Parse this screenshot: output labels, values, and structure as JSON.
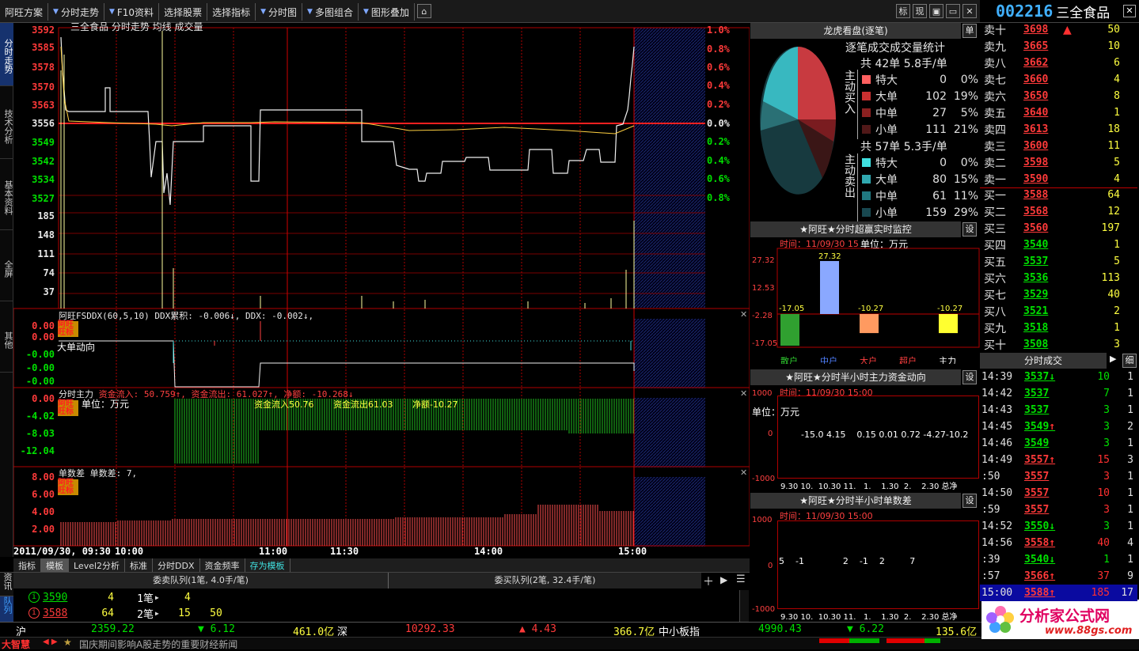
{
  "menu": {
    "items": [
      "阿旺方案",
      "分时走势",
      "F10资料",
      "选择股票",
      "选择指标",
      "分时图",
      "多图组合",
      "图形叠加"
    ],
    "right_buttons": [
      "标",
      "现"
    ]
  },
  "stock": {
    "code": "002216",
    "name": "三全食品"
  },
  "leftnav": [
    "分时走势",
    "技术分析",
    "基本资料",
    "全屏",
    "其他"
  ],
  "chart": {
    "title": "三全食品 分时走势 均线 成交量",
    "price_ticks": [
      "3592",
      "3585",
      "3578",
      "3570",
      "3563",
      "3556",
      "3549",
      "3542",
      "3534",
      "3527"
    ],
    "pct_ticks": [
      "1.0%",
      "0.8%",
      "0.6%",
      "0.4%",
      "0.2%",
      "0.0%",
      "0.2%",
      "0.4%",
      "0.6%",
      "0.8%"
    ],
    "vol_ticks": [
      "185",
      "148",
      "111",
      "74",
      "37"
    ],
    "ddx_label": "阿旺FSDDX(60,5,10)  DDX累积: -0.006↓, DDX: -0.002↓,",
    "ddx_ticks": [
      "0.00",
      "0.00",
      "-0.00",
      "-0.00",
      "-0.00"
    ],
    "ddx_sub": "大单动向",
    "flow_label_a": "分时主力",
    "flow_label_b": "资金流入: 50.759↑, 资金流出: 61.027↑, 净额: -10.268↓",
    "flow_ticks": [
      "0.00",
      "-4.02",
      "-8.03",
      "-12.04"
    ],
    "flow_unit": "单位：万元",
    "flow_in": "资金流入50.76",
    "flow_out": "资金流出61.03",
    "flow_net": "净额-10.27",
    "diff_label": "单数差  单数差: 7,",
    "diff_ticks": [
      "8.00",
      "6.00",
      "4.00",
      "2.00"
    ],
    "badge": "阿旺\n旺标",
    "time_axis": [
      "2011/09/30, 09:30",
      "10:00",
      "11:00",
      "11:30",
      "14:00",
      "15:00"
    ]
  },
  "tabs": [
    "指标",
    "模板",
    "Level2分析",
    "标准",
    "分时DDX",
    "资金频率",
    "存为模板"
  ],
  "queue": {
    "side_tabs": [
      "资讯",
      "队列"
    ],
    "sell_title": "委卖队列(1笔, 4.0手/笔)",
    "buy_title": "委买队列(2笔, 32.4手/笔)",
    "rows": [
      {
        "price": "3590",
        "vol": "4",
        "count": "1笔",
        "items": [
          "4"
        ]
      },
      {
        "price": "3588",
        "vol": "64",
        "count": "2笔",
        "items": [
          "15",
          "50"
        ]
      }
    ]
  },
  "dragon": {
    "header": "龙虎看盘(逐笔)",
    "btn": "单",
    "subtitle": "逐笔成交成交量统计",
    "buy_total": "共 42单 5.8手/单",
    "sell_total": "共 57单 5.3手/单",
    "buy_label": "主动买入",
    "sell_label": "主动卖出",
    "buy_rows": [
      {
        "name": "特大",
        "n": "0",
        "p": "0%",
        "color": "#ff6060"
      },
      {
        "name": "大单",
        "n": "102",
        "p": "19%",
        "color": "#c83030"
      },
      {
        "name": "中单",
        "n": "27",
        "p": "5%",
        "color": "#8a2020"
      },
      {
        "name": "小单",
        "n": "111",
        "p": "21%",
        "color": "#501818"
      }
    ],
    "sell_rows": [
      {
        "name": "特大",
        "n": "0",
        "p": "0%",
        "color": "#40e0e0"
      },
      {
        "name": "大单",
        "n": "80",
        "p": "15%",
        "color": "#30a8b0"
      },
      {
        "name": "中单",
        "n": "61",
        "p": "11%",
        "color": "#207880"
      },
      {
        "name": "小单",
        "n": "159",
        "p": "29%",
        "color": "#184850"
      }
    ]
  },
  "monitor": {
    "header": "★阿旺★分时超赢实时监控",
    "btn": "设",
    "time": "时间：11/09/30 15",
    "unit": "单位：万元",
    "ticks": [
      "27.32",
      "12.53",
      "-2.28",
      "-17.05"
    ],
    "bars": [
      {
        "cat": "散户",
        "val": -17.05,
        "label": "-17.05",
        "color": "#30a030"
      },
      {
        "cat": "中户",
        "val": 27.32,
        "label": "27.32",
        "color": "#8aa8ff"
      },
      {
        "cat": "大户",
        "val": -10.27,
        "label": "-10.27",
        "color": "#ff9a60"
      },
      {
        "cat": "超户",
        "val": 0,
        "label": "",
        "color": "#ff4040"
      },
      {
        "cat": "主力",
        "val": -10.27,
        "label": "-10.27",
        "color": "#ffff30"
      }
    ],
    "colors": {
      "散户": "#30d030",
      "中户": "#5080ff",
      "大户": "#ff4040",
      "超户": "#ff4040",
      "主力": "#ffffff"
    }
  },
  "halfhour": {
    "header": "★阿旺★分时半小时主力资金动向",
    "btn": "设",
    "time": "时间：11/09/30 15:00",
    "unit": "单位：万元",
    "vals": "-15.0 4.15    0.15 0.01 0.72 -4.27-10.2",
    "ticks": [
      "1000",
      "0",
      "-1000"
    ],
    "axis": "9.30 10.  10.30 11.   1.    1.30  2.    2.30 总净"
  },
  "diffhalf": {
    "header": "★阿旺★分时半小时单数差",
    "btn": "设",
    "time": "时间：11/09/30 15:00",
    "vals": "5    -1              2    -1    2         7",
    "ticks": [
      "1000",
      "0",
      "-1000"
    ],
    "axis": "9.30 10.  10.30 11.   1.    1.30  2.    2.30 总净"
  },
  "orderbook": {
    "sells": [
      {
        "l": "卖十",
        "p": "3698",
        "v": "50",
        "up": true
      },
      {
        "l": "卖九",
        "p": "3665",
        "v": "10"
      },
      {
        "l": "卖八",
        "p": "3662",
        "v": "6"
      },
      {
        "l": "卖七",
        "p": "3660",
        "v": "4"
      },
      {
        "l": "卖六",
        "p": "3650",
        "v": "8"
      },
      {
        "l": "卖五",
        "p": "3640",
        "v": "1"
      },
      {
        "l": "卖四",
        "p": "3613",
        "v": "18"
      },
      {
        "l": "卖三",
        "p": "3600",
        "v": "11"
      },
      {
        "l": "卖二",
        "p": "3598",
        "v": "5"
      },
      {
        "l": "卖一",
        "p": "3590",
        "v": "4"
      }
    ],
    "buys": [
      {
        "l": "买一",
        "p": "3588",
        "v": "64",
        "c": "r"
      },
      {
        "l": "买二",
        "p": "3568",
        "v": "12",
        "c": "r"
      },
      {
        "l": "买三",
        "p": "3560",
        "v": "197",
        "c": "r"
      },
      {
        "l": "买四",
        "p": "3540",
        "v": "1",
        "c": "g"
      },
      {
        "l": "买五",
        "p": "3537",
        "v": "5",
        "c": "g"
      },
      {
        "l": "买六",
        "p": "3536",
        "v": "113",
        "c": "g"
      },
      {
        "l": "买七",
        "p": "3529",
        "v": "40",
        "c": "g"
      },
      {
        "l": "买八",
        "p": "3521",
        "v": "2",
        "c": "g"
      },
      {
        "l": "买九",
        "p": "3518",
        "v": "1",
        "c": "g"
      },
      {
        "l": "买十",
        "p": "3508",
        "v": "3",
        "c": "g"
      }
    ]
  },
  "ticks_header": "分时成交",
  "ticks_btn": "细",
  "trades": [
    {
      "t": "14:39",
      "p": "3537",
      "a": "↓",
      "v": "10",
      "n": "1",
      "c": "g"
    },
    {
      "t": "14:42",
      "p": "3537",
      "a": "",
      "v": "7",
      "n": "1",
      "c": "g"
    },
    {
      "t": "14:43",
      "p": "3537",
      "a": "",
      "v": "3",
      "n": "1",
      "c": "g"
    },
    {
      "t": "14:45",
      "p": "3549",
      "a": "↑",
      "v": "3",
      "n": "2",
      "c": "g"
    },
    {
      "t": "14:46",
      "p": "3549",
      "a": "",
      "v": "3",
      "n": "1",
      "c": "g"
    },
    {
      "t": "14:49",
      "p": "3557",
      "a": "↑",
      "v": "15",
      "n": "3",
      "c": "r"
    },
    {
      "t": ":50",
      "p": "3557",
      "a": "",
      "v": "3",
      "n": "1",
      "c": "r"
    },
    {
      "t": "14:50",
      "p": "3557",
      "a": "",
      "v": "10",
      "n": "1",
      "c": "r"
    },
    {
      "t": ":59",
      "p": "3557",
      "a": "",
      "v": "3",
      "n": "1",
      "c": "r"
    },
    {
      "t": "14:52",
      "p": "3550",
      "a": "↓",
      "v": "3",
      "n": "1",
      "c": "g"
    },
    {
      "t": "14:56",
      "p": "3558",
      "a": "↑",
      "v": "40",
      "n": "4",
      "c": "r"
    },
    {
      "t": ":39",
      "p": "3540",
      "a": "↓",
      "v": "1",
      "n": "1",
      "c": "g"
    },
    {
      "t": ":57",
      "p": "3566",
      "a": "↑",
      "v": "37",
      "n": "9",
      "c": "r"
    },
    {
      "t": "15:00",
      "p": "3588",
      "a": "↑",
      "v": "185",
      "n": "17",
      "c": "r"
    }
  ],
  "status": {
    "sh_label": "沪",
    "sh_index": "2359.22",
    "sh_change": "▼ 6.12",
    "sh_amount": "461.0亿",
    "sz_label": "深",
    "sz_index": "10292.33",
    "sz_change": "▲ 4.43",
    "sz_amount": "366.7亿",
    "sme_label": "中小板指",
    "sme_index": "4990.43",
    "sme_change": "▼ 6.22",
    "sme_amount": "135.6亿"
  },
  "bottom": {
    "brand": "大智慧",
    "news": "国庆期间影响A股走势的重要财经新闻"
  },
  "watermark": {
    "title": "分析家公式网",
    "url": "www.88gs.com"
  }
}
